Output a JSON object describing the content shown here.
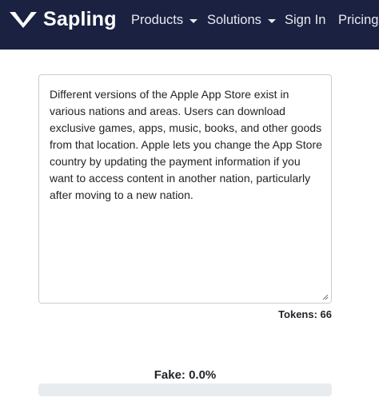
{
  "navbar": {
    "brand_name": "Sapling",
    "items": [
      {
        "label": "Products",
        "has_dropdown": true
      },
      {
        "label": "Solutions",
        "has_dropdown": true
      },
      {
        "label": "Sign In",
        "has_dropdown": false
      },
      {
        "label": "Pricing",
        "has_dropdown": false
      }
    ]
  },
  "detector": {
    "input_text": "Different versions of the Apple App Store exist in various nations and areas. Users can download exclusive games, apps, music, books, and other goods from that location. Apple lets you change the App Store country by updating the payment information if you want to access content in another nation, particularly after moving to a new nation.",
    "tokens_label": "Tokens: 66",
    "fake_label": "Fake: 0.0%",
    "fake_fraction": 0.0
  },
  "colors": {
    "navbar_bg": "#1b2140",
    "progress_track": "#e9ecef"
  }
}
